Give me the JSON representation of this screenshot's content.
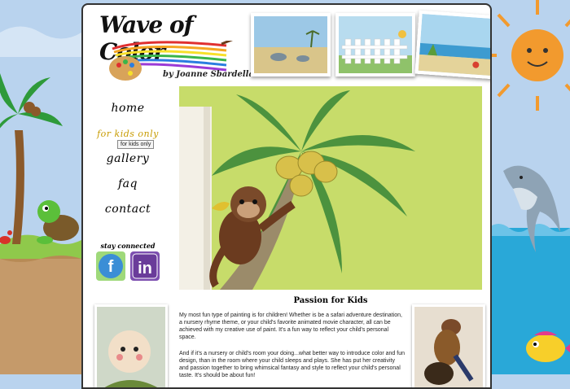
{
  "logo": {
    "title": "Wave of Color",
    "byline": "by Joanne Sbardella"
  },
  "nav": [
    {
      "label": "home"
    },
    {
      "label": "for kids only",
      "active": true
    },
    {
      "label": "gallery"
    },
    {
      "label": "faq"
    },
    {
      "label": "contact"
    }
  ],
  "tooltip": "for kids only",
  "social": {
    "heading": "stay connected",
    "facebook": "f",
    "linkedin": "in"
  },
  "content": {
    "title": "Passion for Kids",
    "paragraph1": "My most fun type of painting is for children! Whether is be a safari adventure destination, a nursery rhyme theme, or your child's favorite animated movie character, all can be achieved with my creative use of paint. It's a fun way to reflect your child's personal space.",
    "paragraph2": "And if it's a nursery or child's room your doing...what better way to introduce color and fun design, than in the room where your child sleeps and plays. She has put her creativity and passion together to bring whimsical fantasy and style to reflect your child's personal taste. It's should be about fun!"
  },
  "colors": {
    "sky": "#b9d3ee",
    "grass": "#8fc94b",
    "water": "#29a8d8",
    "sun": "#f29a2e"
  }
}
